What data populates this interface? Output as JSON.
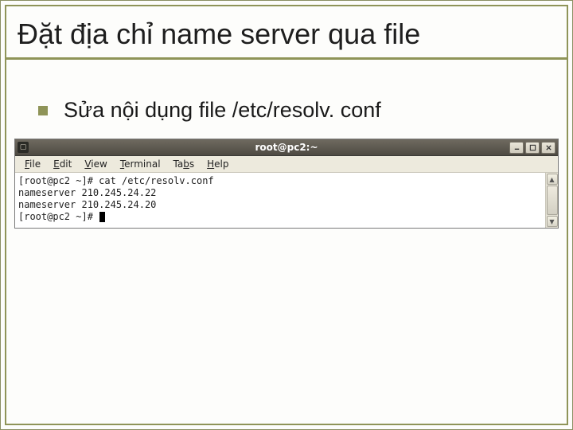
{
  "slide": {
    "title": "Đặt địa chỉ name server qua file",
    "bullet": "Sửa nội dụng file /etc/resolv. conf"
  },
  "terminal": {
    "window_title": "root@pc2:~",
    "menu": {
      "file": "File",
      "edit": "Edit",
      "view": "View",
      "terminal": "Terminal",
      "tabs": "Tabs",
      "help": "Help"
    },
    "lines": {
      "l0": "[root@pc2 ~]# cat /etc/resolv.conf",
      "l1": "nameserver 210.245.24.22",
      "l2": "nameserver 210.245.24.20",
      "l3": "[root@pc2 ~]# "
    }
  }
}
